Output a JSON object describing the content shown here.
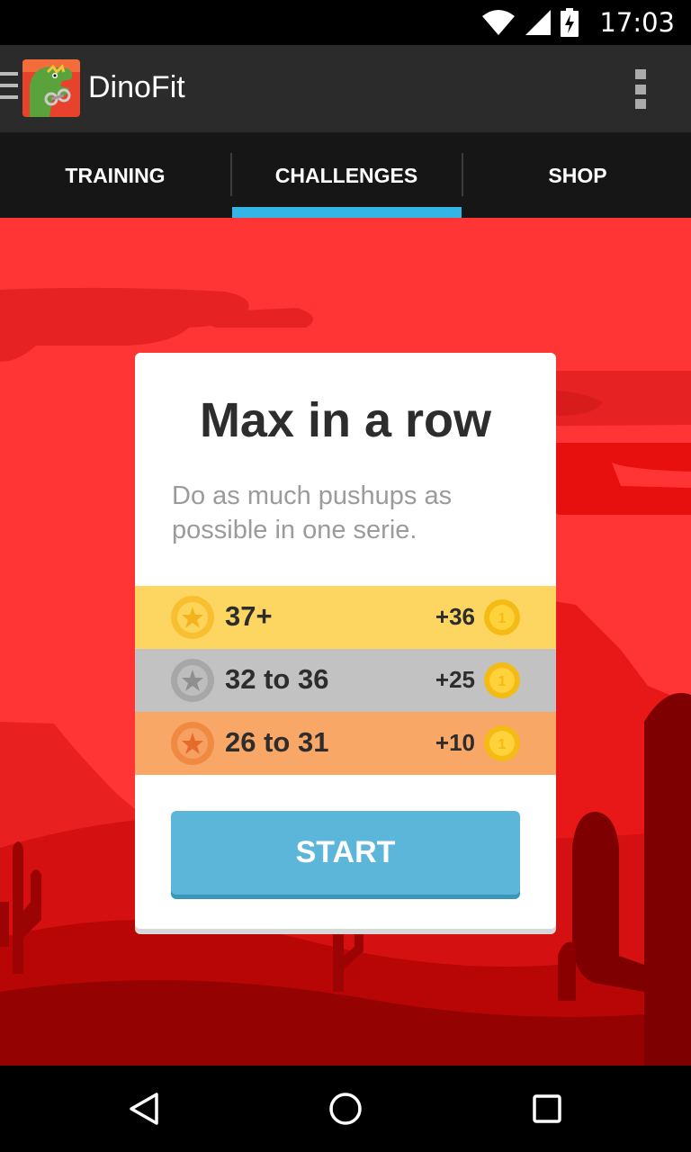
{
  "status_bar": {
    "time": "17:03",
    "icons": [
      "wifi-icon",
      "signal-icon",
      "battery-charging-icon"
    ]
  },
  "action_bar": {
    "app_title": "DinoFit",
    "icons": [
      "drawer-icon",
      "app-logo",
      "overflow-menu-icon"
    ]
  },
  "tabs": [
    {
      "label": "TRAINING",
      "selected": false
    },
    {
      "label": "CHALLENGES",
      "selected": true
    },
    {
      "label": "SHOP",
      "selected": false
    }
  ],
  "card": {
    "title": "Max in a row",
    "description": "Do as much pushups as possible in one serie.",
    "tiers": [
      {
        "medal": "gold-medal-icon",
        "range": "37+",
        "reward": "+36",
        "coin": "coin-icon"
      },
      {
        "medal": "silver-medal-icon",
        "range": "32 to 36",
        "reward": "+25",
        "coin": "coin-icon"
      },
      {
        "medal": "bronze-medal-icon",
        "range": "26 to 31",
        "reward": "+10",
        "coin": "coin-icon"
      }
    ],
    "start_label": "START"
  },
  "nav_bar": {
    "icons": [
      "back-icon",
      "home-icon",
      "recents-icon"
    ]
  },
  "colors": {
    "accent": "#33b5e5",
    "background": "#ff3434",
    "start_button": "#5bb6da",
    "gold": "#fdd662",
    "silver": "#c2c2c2",
    "bronze": "#f8a767"
  }
}
